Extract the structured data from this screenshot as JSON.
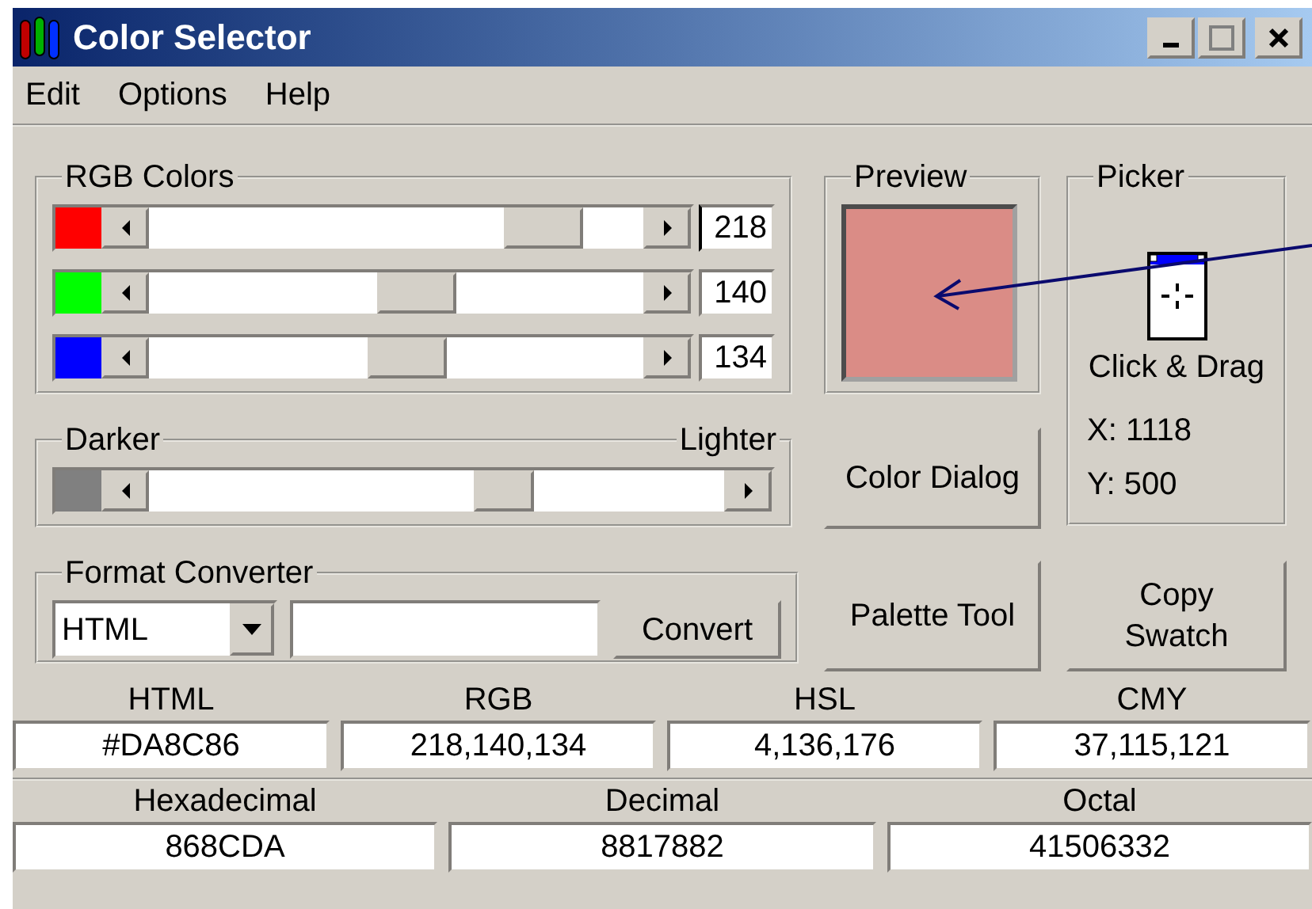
{
  "window": {
    "title": "Color Selector"
  },
  "menu": [
    "Edit",
    "Options",
    "Help"
  ],
  "rgb_colors": {
    "label": "RGB Colors",
    "channels": [
      {
        "color": "#ff0000",
        "level": 0.855,
        "value": "218",
        "focused": true
      },
      {
        "color": "#00ff00",
        "level": 0.549,
        "value": "140",
        "focused": false
      },
      {
        "color": "#0000ff",
        "level": 0.525,
        "value": "134",
        "focused": false
      }
    ]
  },
  "preview": {
    "label": "Preview",
    "color": "#da8c86"
  },
  "picker": {
    "label": "Picker",
    "hint": "Click & Drag",
    "x": "X: 1118",
    "y": "Y: 500"
  },
  "brightness": {
    "left_label": "Darker",
    "right_label": "Lighter",
    "level": 0.63
  },
  "format_converter": {
    "label": "Format Converter",
    "format": "HTML",
    "button": {
      "label": "Convert"
    }
  },
  "buttons": [
    {
      "label": "Color Dialog"
    },
    {
      "label": "Palette Tool"
    },
    {
      "label": "Copy Swatch"
    }
  ],
  "formats": [
    {
      "label": "HTML",
      "value": "#DA8C86"
    },
    {
      "label": "RGB",
      "value": "218,140,134"
    },
    {
      "label": "HSL",
      "value": "4,136,176"
    },
    {
      "label": "CMY",
      "value": "37,115,121"
    }
  ],
  "number_formats": [
    {
      "label": "Hexadecimal",
      "value": "868CDA"
    },
    {
      "label": "Decimal",
      "value": "8817882"
    },
    {
      "label": "Octal",
      "value": "41506332"
    }
  ]
}
